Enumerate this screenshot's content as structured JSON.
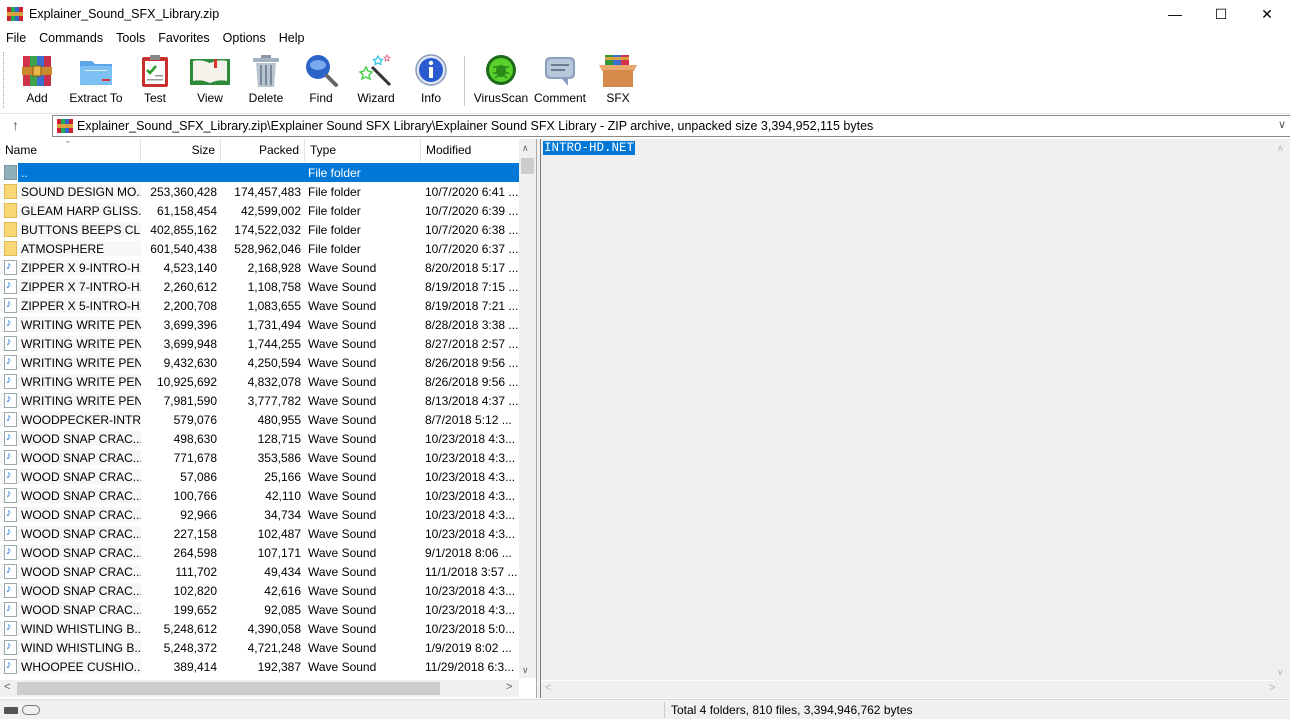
{
  "window": {
    "title": "Explainer_Sound_SFX_Library.zip",
    "minimize_glyph": "—",
    "maximize_glyph": "☐",
    "close_glyph": "✕"
  },
  "menu": [
    "File",
    "Commands",
    "Tools",
    "Favorites",
    "Options",
    "Help"
  ],
  "toolbar": [
    {
      "label": "Add",
      "icon": "add-archive-icon"
    },
    {
      "label": "Extract To",
      "icon": "extract-folder-icon"
    },
    {
      "label": "Test",
      "icon": "test-clipboard-icon"
    },
    {
      "label": "View",
      "icon": "view-book-icon"
    },
    {
      "label": "Delete",
      "icon": "trash-icon"
    },
    {
      "label": "Find",
      "icon": "magnifier-icon"
    },
    {
      "label": "Wizard",
      "icon": "magic-wand-icon"
    },
    {
      "label": "Info",
      "icon": "info-icon"
    },
    {
      "label": "VirusScan",
      "icon": "virus-scan-icon"
    },
    {
      "label": "Comment",
      "icon": "comment-icon"
    },
    {
      "label": "SFX",
      "icon": "sfx-box-icon"
    }
  ],
  "address": {
    "up_glyph": "↑",
    "path": "Explainer_Sound_SFX_Library.zip\\Explainer Sound SFX Library\\Explainer Sound SFX Library - ZIP archive, unpacked size 3,394,952,115 bytes",
    "dropdown_glyph": "∨"
  },
  "columns": {
    "name": "Name",
    "size": "Size",
    "packed": "Packed",
    "type": "Type",
    "modified": "Modified"
  },
  "files": [
    {
      "name": "..",
      "size": "",
      "packed": "",
      "type": "File folder",
      "modified": "",
      "kind": "up",
      "selected": true
    },
    {
      "name": "SOUND DESIGN MO...",
      "size": "253,360,428",
      "packed": "174,457,483",
      "type": "File folder",
      "modified": "10/7/2020 6:41 ...",
      "kind": "folder"
    },
    {
      "name": "GLEAM HARP GLISS...",
      "size": "61,158,454",
      "packed": "42,599,002",
      "type": "File folder",
      "modified": "10/7/2020 6:39 ...",
      "kind": "folder"
    },
    {
      "name": "BUTTONS BEEPS CLI...",
      "size": "402,855,162",
      "packed": "174,522,032",
      "type": "File folder",
      "modified": "10/7/2020 6:38 ...",
      "kind": "folder"
    },
    {
      "name": "ATMOSPHERE",
      "size": "601,540,438",
      "packed": "528,962,046",
      "type": "File folder",
      "modified": "10/7/2020 6:37 ...",
      "kind": "folder"
    },
    {
      "name": "ZIPPER X 9-INTRO-H...",
      "size": "4,523,140",
      "packed": "2,168,928",
      "type": "Wave Sound",
      "modified": "8/20/2018 5:17 ...",
      "kind": "wave"
    },
    {
      "name": "ZIPPER X 7-INTRO-H...",
      "size": "2,260,612",
      "packed": "1,108,758",
      "type": "Wave Sound",
      "modified": "8/19/2018 7:15 ...",
      "kind": "wave"
    },
    {
      "name": "ZIPPER X 5-INTRO-H...",
      "size": "2,200,708",
      "packed": "1,083,655",
      "type": "Wave Sound",
      "modified": "8/19/2018 7:21 ...",
      "kind": "wave"
    },
    {
      "name": "WRITING WRITE PEN...",
      "size": "3,699,396",
      "packed": "1,731,494",
      "type": "Wave Sound",
      "modified": "8/28/2018 3:38 ...",
      "kind": "wave"
    },
    {
      "name": "WRITING WRITE PEN...",
      "size": "3,699,948",
      "packed": "1,744,255",
      "type": "Wave Sound",
      "modified": "8/27/2018 2:57 ...",
      "kind": "wave"
    },
    {
      "name": "WRITING WRITE PEN...",
      "size": "9,432,630",
      "packed": "4,250,594",
      "type": "Wave Sound",
      "modified": "8/26/2018 9:56 ...",
      "kind": "wave"
    },
    {
      "name": "WRITING WRITE PEN...",
      "size": "10,925,692",
      "packed": "4,832,078",
      "type": "Wave Sound",
      "modified": "8/26/2018 9:56 ...",
      "kind": "wave"
    },
    {
      "name": "WRITING WRITE PEN...",
      "size": "7,981,590",
      "packed": "3,777,782",
      "type": "Wave Sound",
      "modified": "8/13/2018 4:37 ...",
      "kind": "wave"
    },
    {
      "name": "WOODPECKER-INTR...",
      "size": "579,076",
      "packed": "480,955",
      "type": "Wave Sound",
      "modified": "8/7/2018 5:12 ...",
      "kind": "wave"
    },
    {
      "name": "WOOD SNAP CRAC...",
      "size": "498,630",
      "packed": "128,715",
      "type": "Wave Sound",
      "modified": "10/23/2018 4:3...",
      "kind": "wave"
    },
    {
      "name": "WOOD SNAP CRAC...",
      "size": "771,678",
      "packed": "353,586",
      "type": "Wave Sound",
      "modified": "10/23/2018 4:3...",
      "kind": "wave"
    },
    {
      "name": "WOOD SNAP CRAC...",
      "size": "57,086",
      "packed": "25,166",
      "type": "Wave Sound",
      "modified": "10/23/2018 4:3...",
      "kind": "wave"
    },
    {
      "name": "WOOD SNAP CRAC...",
      "size": "100,766",
      "packed": "42,110",
      "type": "Wave Sound",
      "modified": "10/23/2018 4:3...",
      "kind": "wave"
    },
    {
      "name": "WOOD SNAP CRAC...",
      "size": "92,966",
      "packed": "34,734",
      "type": "Wave Sound",
      "modified": "10/23/2018 4:3...",
      "kind": "wave"
    },
    {
      "name": "WOOD SNAP CRAC...",
      "size": "227,158",
      "packed": "102,487",
      "type": "Wave Sound",
      "modified": "10/23/2018 4:3...",
      "kind": "wave"
    },
    {
      "name": "WOOD SNAP CRAC...",
      "size": "264,598",
      "packed": "107,171",
      "type": "Wave Sound",
      "modified": "9/1/2018 8:06 ...",
      "kind": "wave"
    },
    {
      "name": "WOOD SNAP CRAC...",
      "size": "111,702",
      "packed": "49,434",
      "type": "Wave Sound",
      "modified": "11/1/2018 3:57 ...",
      "kind": "wave"
    },
    {
      "name": "WOOD SNAP CRAC...",
      "size": "102,820",
      "packed": "42,616",
      "type": "Wave Sound",
      "modified": "10/23/2018 4:3...",
      "kind": "wave"
    },
    {
      "name": "WOOD SNAP CRAC...",
      "size": "199,652",
      "packed": "92,085",
      "type": "Wave Sound",
      "modified": "10/23/2018 4:3...",
      "kind": "wave"
    },
    {
      "name": "WIND WHISTLING B...",
      "size": "5,248,612",
      "packed": "4,390,058",
      "type": "Wave Sound",
      "modified": "10/23/2018 5:0...",
      "kind": "wave"
    },
    {
      "name": "WIND WHISTLING B...",
      "size": "5,248,372",
      "packed": "4,721,248",
      "type": "Wave Sound",
      "modified": "1/9/2019 8:02 ...",
      "kind": "wave"
    },
    {
      "name": "WHOOPEE CUSHIO...",
      "size": "389,414",
      "packed": "192,387",
      "type": "Wave Sound",
      "modified": "11/29/2018 6:3...",
      "kind": "wave"
    }
  ],
  "comment": {
    "text": "INTRO-HD.NET"
  },
  "scroll_glyphs": {
    "up": "∧",
    "down": "∨",
    "left": "<",
    "right": ">"
  },
  "status": {
    "total": "Total 4 folders, 810 files, 3,394,946,762 bytes"
  },
  "colors": {
    "selection": "#0078d7",
    "folder": "#f8d775"
  }
}
